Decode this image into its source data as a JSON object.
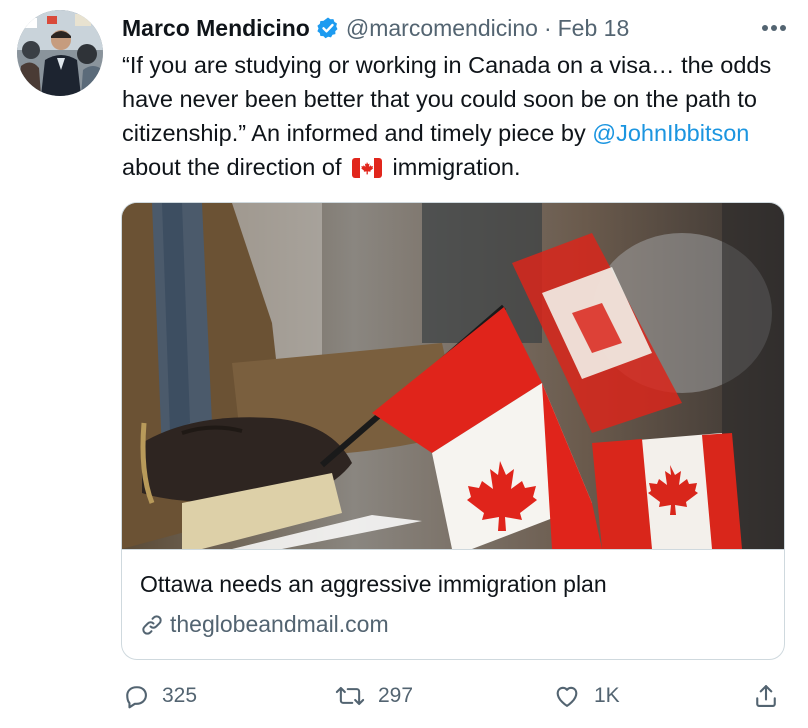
{
  "tweet": {
    "author_name": "Marco Mendicino",
    "handle": "@marcomendicino",
    "separator": "·",
    "date": "Feb 18",
    "text_part1": "“If you are studying or working in Canada on a visa… the odds have never been better that you could soon be on the path to citizenship.” An informed and timely piece by ",
    "mention": "@JohnIbbitson",
    "text_part2": " about the direction of ",
    "text_part3": " immigration."
  },
  "card": {
    "title": "Ottawa needs an aggressive immigration plan",
    "domain": "theglobeandmail.com"
  },
  "actions": {
    "replies": "325",
    "retweets": "297",
    "likes": "1K"
  },
  "colors": {
    "link": "#1b95e0",
    "verified": "#1d9bf0",
    "secondary_text": "#536471",
    "flag_red": "#e1261c"
  },
  "icons": [
    "verified-badge-icon",
    "more-icon",
    "link-icon",
    "reply-icon",
    "retweet-icon",
    "like-icon",
    "share-icon",
    "canada-flag-emoji"
  ]
}
